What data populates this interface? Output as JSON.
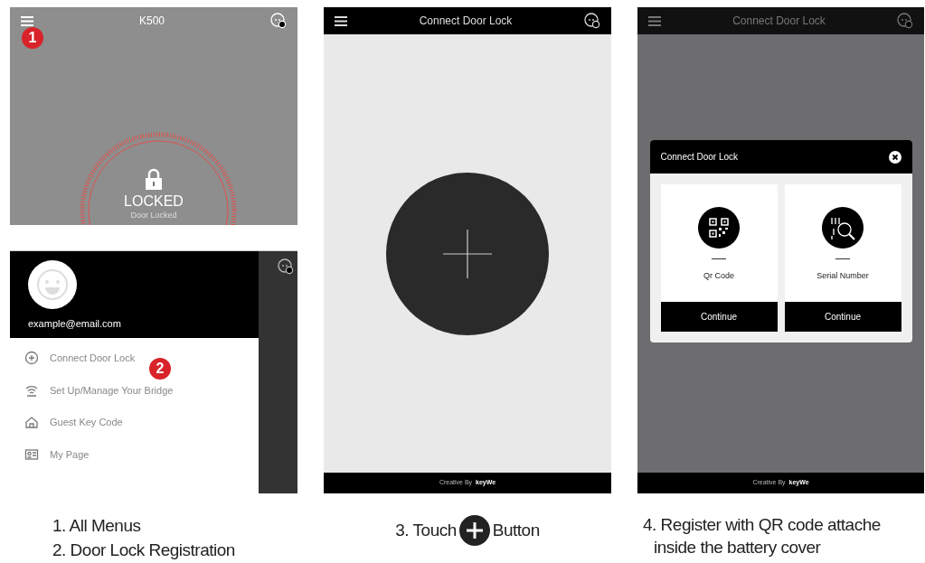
{
  "home_screen": {
    "title": "K500",
    "lock_status": "LOCKED",
    "lock_detail": "Door Locked",
    "marker": "1"
  },
  "menu_screen": {
    "email": "example@email.com",
    "marker": "2",
    "items": [
      {
        "label": "Connect Door Lock",
        "kind": "add"
      },
      {
        "label": "Set Up/Manage Your Bridge",
        "kind": "bridge"
      },
      {
        "label": "Guest Key Code",
        "kind": "guest"
      },
      {
        "label": "My Page",
        "kind": "profile"
      }
    ]
  },
  "connect_screen": {
    "title": "Connect Door Lock",
    "footer_prefix": "Creative By",
    "footer_brand": "keyWe"
  },
  "register_screen": {
    "title": "Connect Door Lock",
    "dialog_title": "Connect Door Lock",
    "footer_prefix": "Creative By",
    "footer_brand": "keyWe",
    "options": [
      {
        "label": "Qr Code",
        "kind": "qr",
        "button": "Continue"
      },
      {
        "label": "Serial Number",
        "kind": "serial",
        "button": "Continue"
      }
    ]
  },
  "captions": {
    "step_1": "1. All Menus",
    "step_2": "2. Door Lock Registration",
    "step_3_before": "3. Touch",
    "step_3_after": "Button",
    "step_4_line_1": "4. Register with QR code attache",
    "step_4_line_2": "inside the battery cover"
  }
}
